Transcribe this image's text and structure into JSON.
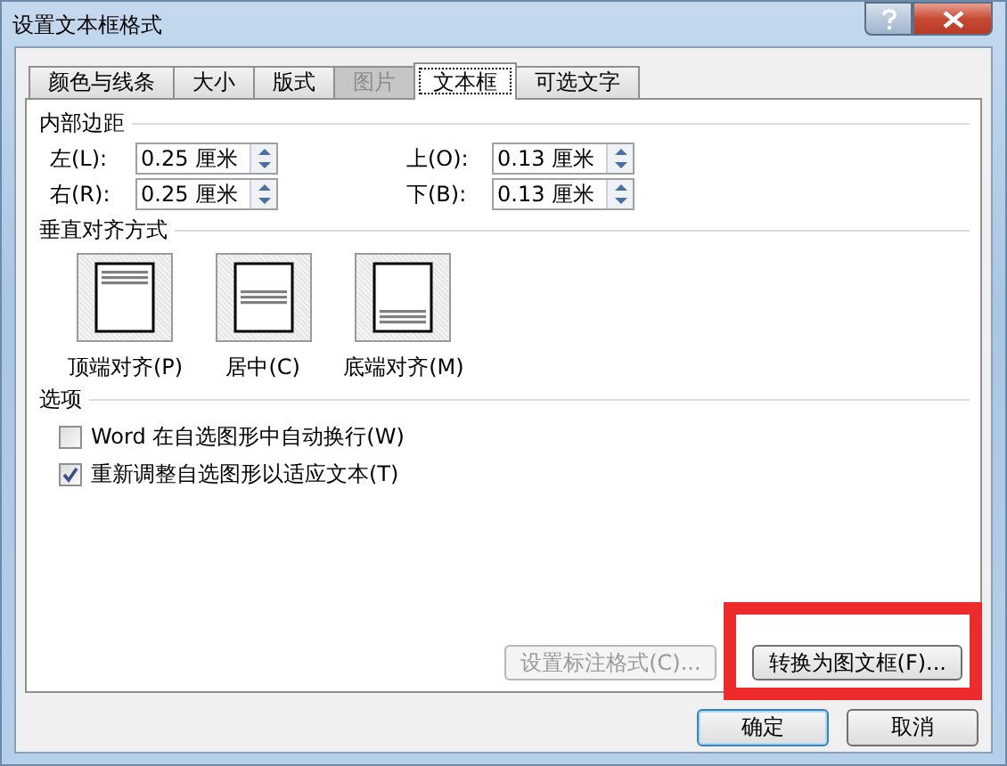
{
  "window": {
    "title": "设置文本框格式"
  },
  "tabs": [
    {
      "label": "颜色与线条",
      "selected": false,
      "disabled": false
    },
    {
      "label": "大小",
      "selected": false,
      "disabled": false
    },
    {
      "label": "版式",
      "selected": false,
      "disabled": false
    },
    {
      "label": "图片",
      "selected": false,
      "disabled": true
    },
    {
      "label": "文本框",
      "selected": true,
      "disabled": false
    },
    {
      "label": "可选文字",
      "selected": false,
      "disabled": false
    }
  ],
  "internal_margin": {
    "title": "内部边距",
    "fields": [
      {
        "label": "左(L):",
        "value": "0.25 厘米"
      },
      {
        "label": "上(O):",
        "value": "0.13 厘米"
      },
      {
        "label": "右(R):",
        "value": "0.25 厘米"
      },
      {
        "label": "下(B):",
        "value": "0.13 厘米"
      }
    ]
  },
  "vertical_alignment": {
    "title": "垂直对齐方式",
    "options": [
      {
        "label": "顶端对齐(P)",
        "kind": "top"
      },
      {
        "label": "居中(C)",
        "kind": "middle"
      },
      {
        "label": "底端对齐(M)",
        "kind": "bottom"
      }
    ]
  },
  "options": {
    "title": "选项",
    "checkboxes": [
      {
        "label": "Word 在自选图形中自动换行(W)",
        "checked": false
      },
      {
        "label": "重新调整自选图形以适应文本(T)",
        "checked": true
      }
    ]
  },
  "panel_buttons": [
    {
      "label": "设置标注格式(C)...",
      "disabled": true,
      "highlighted": false
    },
    {
      "label": "转换为图文框(F)...",
      "disabled": false,
      "highlighted": true
    }
  ],
  "dialog_buttons": [
    {
      "label": "确定",
      "default": true
    },
    {
      "label": "取消",
      "default": false
    }
  ]
}
